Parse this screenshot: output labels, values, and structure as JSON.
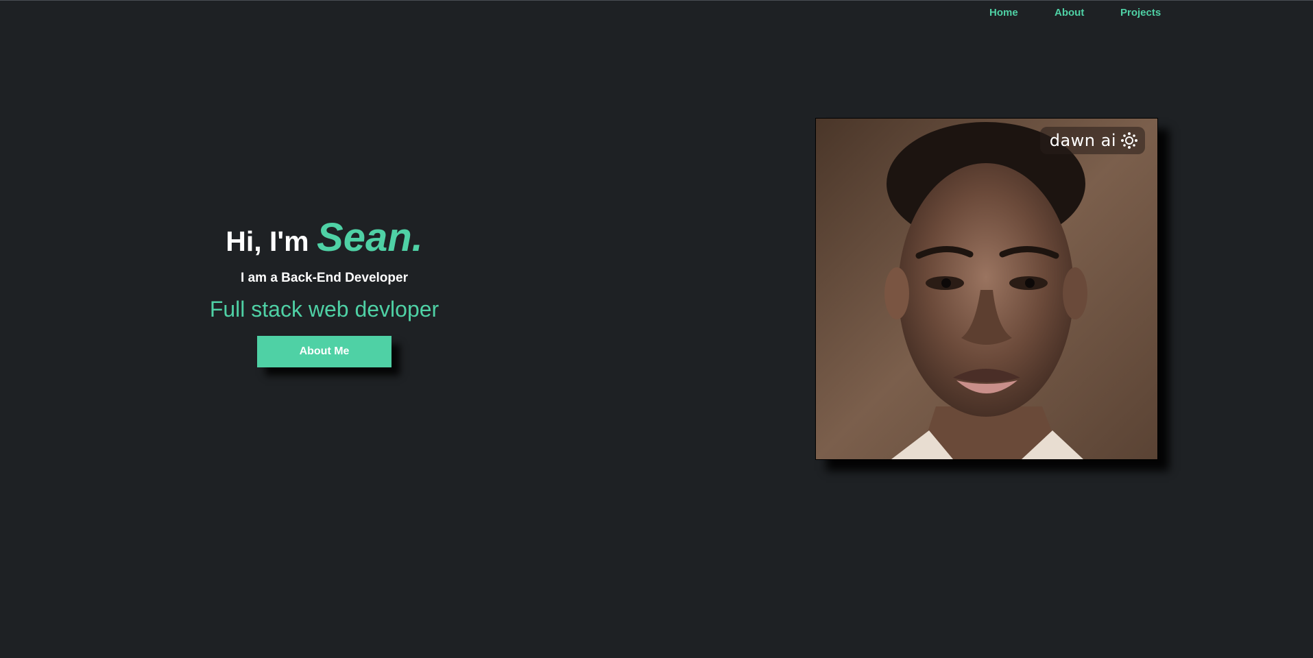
{
  "nav": {
    "home": "Home",
    "about": "About",
    "projects": "Projects"
  },
  "hero": {
    "greeting": "Hi, I'm",
    "name": "Sean.",
    "role": "I am a Back-End Developer",
    "tagline": "Full stack web devloper",
    "button": "About Me"
  },
  "portrait": {
    "watermark": "dawn ai",
    "watermark_icon": "sparkle-icon"
  },
  "colors": {
    "background": "#1e2124",
    "accent": "#4fd1a5",
    "text": "#ffffff"
  }
}
